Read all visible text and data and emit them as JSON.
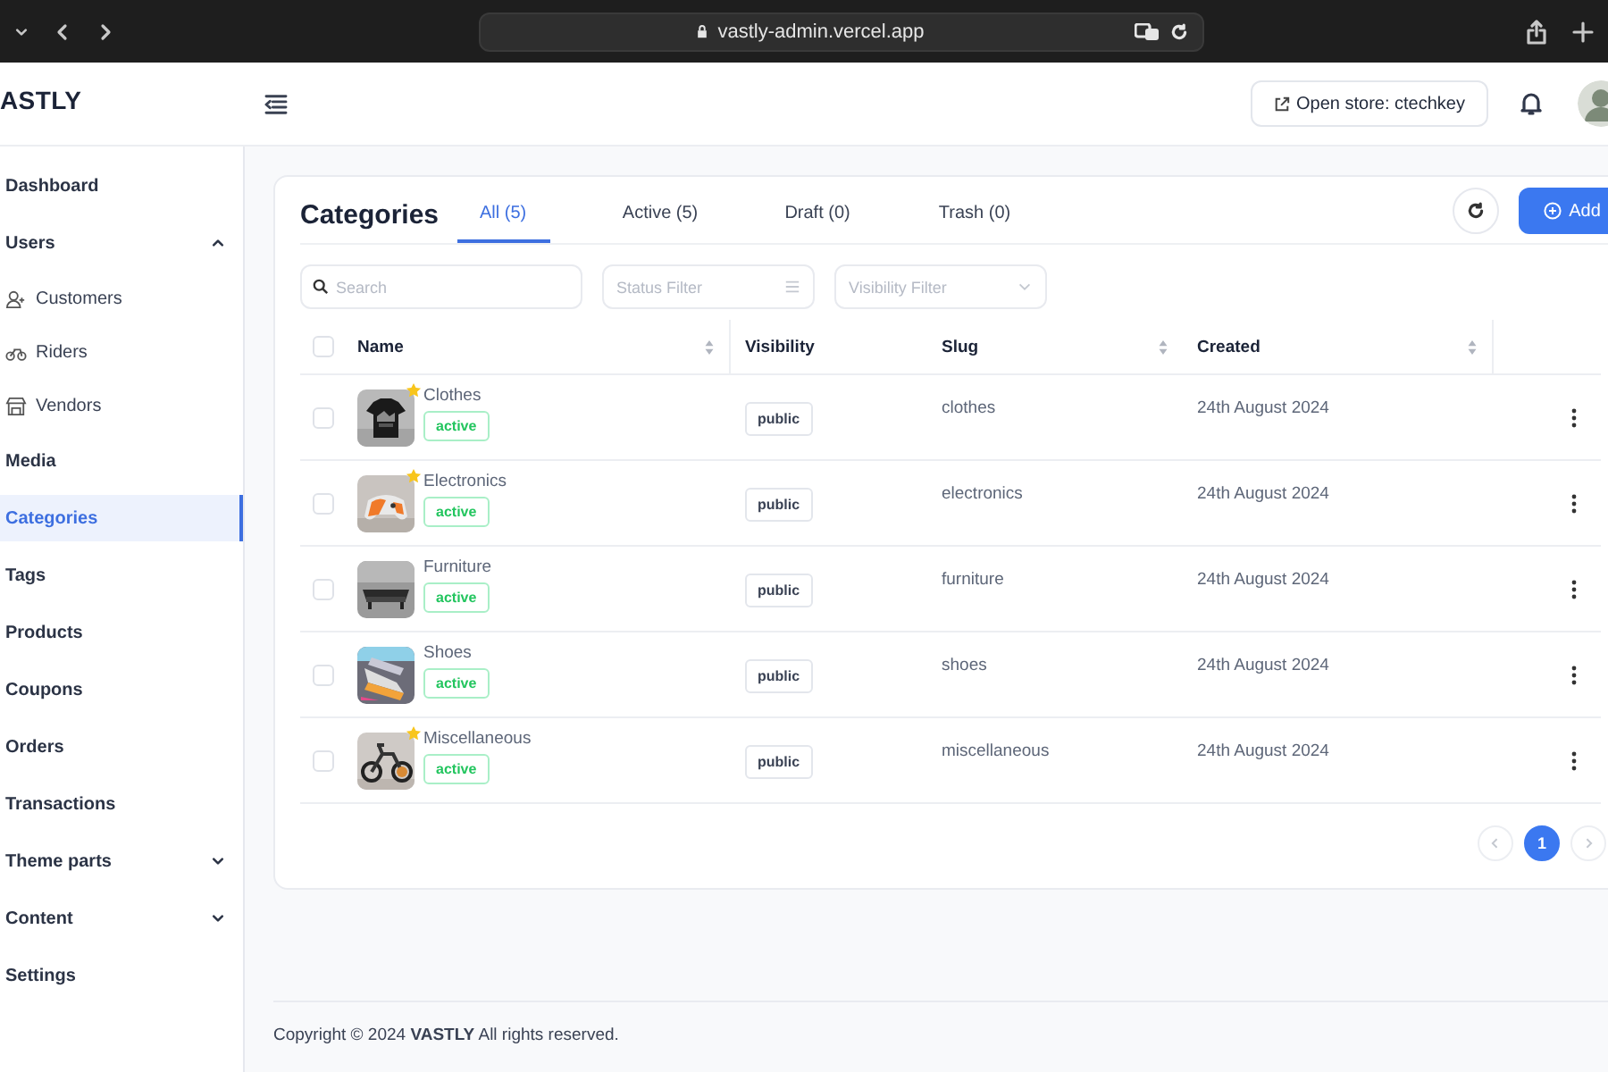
{
  "browser": {
    "url": "vastly-admin.vercel.app"
  },
  "header": {
    "logo": "ASTLY",
    "store_button": "Open store: ctechkey"
  },
  "sidebar": {
    "items": [
      {
        "label": "Dashboard",
        "selected": false
      },
      {
        "label": "Users",
        "selected": false,
        "expanded": true,
        "children": [
          {
            "label": "Customers",
            "selected": false
          },
          {
            "label": "Riders",
            "selected": false
          },
          {
            "label": "Vendors",
            "selected": false
          }
        ]
      },
      {
        "label": "Media",
        "selected": false
      },
      {
        "label": "Categories",
        "selected": true
      },
      {
        "label": "Tags",
        "selected": false
      },
      {
        "label": "Products",
        "selected": false
      },
      {
        "label": "Coupons",
        "selected": false
      },
      {
        "label": "Orders",
        "selected": false
      },
      {
        "label": "Transactions",
        "selected": false
      },
      {
        "label": "Theme parts",
        "selected": false,
        "expanded": false
      },
      {
        "label": "Content",
        "selected": false,
        "expanded": false
      },
      {
        "label": "Settings",
        "selected": false
      }
    ]
  },
  "page": {
    "title": "Categories",
    "tabs": [
      {
        "label": "All (5)",
        "selected": true
      },
      {
        "label": "Active (5)",
        "selected": false
      },
      {
        "label": "Draft (0)",
        "selected": false
      },
      {
        "label": "Trash (0)",
        "selected": false
      }
    ],
    "add_button": "Add",
    "search": {
      "placeholder": "Search"
    },
    "filters": [
      {
        "placeholder": "Status Filter",
        "kind": "list"
      },
      {
        "placeholder": "Visibility Filter",
        "kind": "select"
      }
    ],
    "table": {
      "select_all": {
        "checked": false
      },
      "columns": [
        {
          "label": "Name",
          "sortable": true
        },
        {
          "label": "Visibility",
          "sortable": false
        },
        {
          "label": "Slug",
          "sortable": true
        },
        {
          "label": "Created",
          "sortable": true
        }
      ],
      "rows": [
        {
          "checked": false,
          "name": "Clothes",
          "featured": true,
          "status": "active",
          "visibility": "public",
          "slug": "clothes",
          "created": "24th August 2024"
        },
        {
          "checked": false,
          "name": "Electronics",
          "featured": true,
          "status": "active",
          "visibility": "public",
          "slug": "electronics",
          "created": "24th August 2024"
        },
        {
          "checked": false,
          "name": "Furniture",
          "featured": false,
          "status": "active",
          "visibility": "public",
          "slug": "furniture",
          "created": "24th August 2024"
        },
        {
          "checked": false,
          "name": "Shoes",
          "featured": false,
          "status": "active",
          "visibility": "public",
          "slug": "shoes",
          "created": "24th August 2024"
        },
        {
          "checked": false,
          "name": "Miscellaneous",
          "featured": true,
          "status": "active",
          "visibility": "public",
          "slug": "miscellaneous",
          "created": "24th August 2024"
        }
      ]
    },
    "pagination": {
      "pages": [
        {
          "label": "1",
          "selected": true
        }
      ]
    }
  },
  "footer": {
    "text": "Copyright © 2024 **VASTLY** All rights reserved."
  }
}
